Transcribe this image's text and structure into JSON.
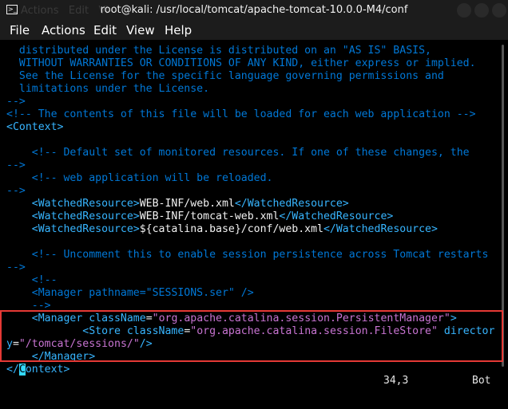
{
  "window": {
    "title": "root@kali: /usr/local/tomcat/apache-tomcat-10.0.0-M4/conf",
    "ghost_menu": "Actions   Edit   Vi"
  },
  "menubar": {
    "items": [
      "File",
      "Actions",
      "Edit",
      "View",
      "Help"
    ]
  },
  "editor": {
    "lines": [
      [
        {
          "c": "com",
          "t": "  distributed under the License is distributed on an \"AS IS\" BASIS,"
        }
      ],
      [
        {
          "c": "com",
          "t": "  WITHOUT WARRANTIES OR CONDITIONS OF ANY KIND, either express or implied."
        }
      ],
      [
        {
          "c": "com",
          "t": "  See the License for the specific language governing permissions and"
        }
      ],
      [
        {
          "c": "com",
          "t": "  limitations under the License."
        }
      ],
      [
        {
          "c": "com",
          "t": "-->"
        }
      ],
      [
        {
          "c": "com",
          "t": "<!-- The contents of this file will be loaded for each web application -->"
        }
      ],
      [
        {
          "c": "tag",
          "t": "<Context>"
        }
      ],
      [
        {
          "c": "com",
          "t": ""
        }
      ],
      [
        {
          "c": "com",
          "t": "    <!-- Default set of monitored resources. If one of these changes, the"
        }
      ],
      [
        {
          "c": "com",
          "t": "-->"
        }
      ],
      [
        {
          "c": "com",
          "t": "    <!-- web application will be reloaded."
        }
      ],
      [
        {
          "c": "com",
          "t": "-->"
        }
      ],
      [
        {
          "c": "tag",
          "t": "    <WatchedResource>"
        },
        {
          "c": "txt",
          "t": "WEB-INF/web.xml"
        },
        {
          "c": "tag",
          "t": "</WatchedResource>"
        }
      ],
      [
        {
          "c": "tag",
          "t": "    <WatchedResource>"
        },
        {
          "c": "txt",
          "t": "WEB-INF/tomcat-web.xml"
        },
        {
          "c": "tag",
          "t": "</WatchedResource>"
        }
      ],
      [
        {
          "c": "tag",
          "t": "    <WatchedResource>"
        },
        {
          "c": "txt",
          "t": "${catalina.base}/conf/web.xml"
        },
        {
          "c": "tag",
          "t": "</WatchedResource>"
        }
      ],
      [
        {
          "c": "com",
          "t": ""
        }
      ],
      [
        {
          "c": "com",
          "t": "    <!-- Uncomment this to enable session persistence across Tomcat restarts"
        }
      ],
      [
        {
          "c": "com",
          "t": "-->"
        }
      ],
      [
        {
          "c": "com",
          "t": "    <!--"
        }
      ],
      [
        {
          "c": "com",
          "t": "    <Manager pathname=\"SESSIONS.ser\" />"
        }
      ],
      [
        {
          "c": "com",
          "t": "    -->"
        }
      ],
      [
        {
          "c": "tag",
          "t": "    <Manager "
        },
        {
          "c": "attr",
          "t": "className"
        },
        {
          "c": "txt",
          "t": "="
        },
        {
          "c": "val",
          "t": "\"org.apache.catalina.session.PersistentManager\""
        },
        {
          "c": "tag",
          "t": ">"
        }
      ],
      [
        {
          "c": "tag",
          "t": "            <Store "
        },
        {
          "c": "attr",
          "t": "className"
        },
        {
          "c": "txt",
          "t": "="
        },
        {
          "c": "val",
          "t": "\"org.apache.catalina.session.FileStore\""
        },
        {
          "c": "attr",
          "t": " director"
        }
      ],
      [
        {
          "c": "attr",
          "t": "y"
        },
        {
          "c": "txt",
          "t": "="
        },
        {
          "c": "val",
          "t": "\"/tomcat/sessions/\""
        },
        {
          "c": "tag",
          "t": "/>"
        }
      ],
      [
        {
          "c": "tag",
          "t": "    </Manager>"
        }
      ],
      [
        {
          "c": "tag",
          "t": "</"
        },
        {
          "c": "cur",
          "t": "C"
        },
        {
          "c": "tag",
          "t": "ontext>"
        }
      ]
    ]
  },
  "status": {
    "position": "34,3",
    "scroll": "Bot"
  },
  "colors": {
    "comment": "#0078d7",
    "tag": "#37b5ff",
    "text": "#f2f2f2",
    "attr_value": "#c874d2",
    "highlight_box": "#e53935",
    "background": "#000000"
  }
}
